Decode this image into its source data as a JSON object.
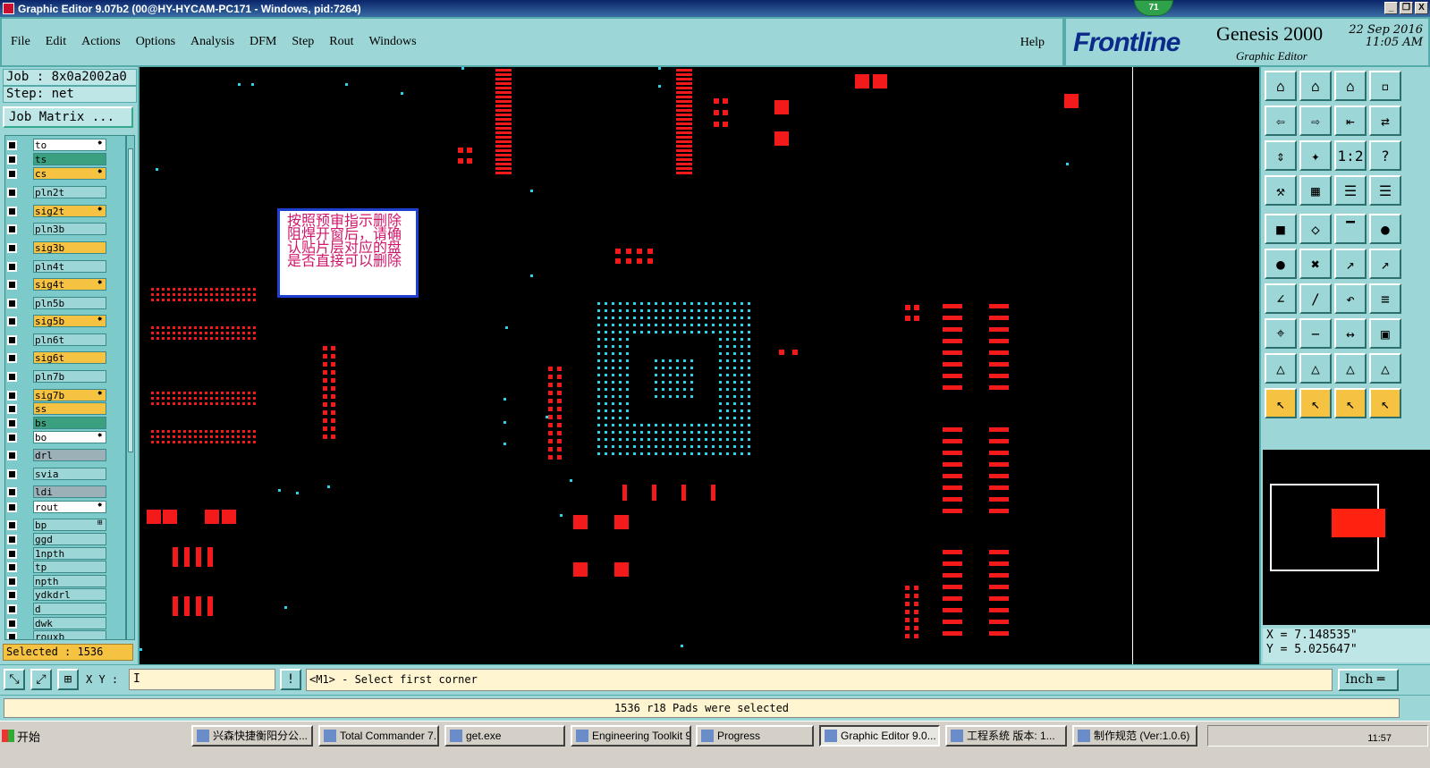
{
  "window": {
    "title": "Graphic Editor 9.07b2 (00@HY-HYCAM-PC171 - Windows, pid:7264)",
    "badge": "71",
    "controls": [
      "_",
      "❐",
      "X"
    ]
  },
  "menu": {
    "items": [
      "File",
      "Edit",
      "Actions",
      "Options",
      "Analysis",
      "DFM",
      "Step",
      "Rout",
      "Windows"
    ],
    "help": "Help"
  },
  "brand": {
    "logo": "Frontline",
    "product": "Genesis 2000",
    "subtitle": "Graphic Editor",
    "date": "22 Sep 2016",
    "time": "11:05 AM"
  },
  "left": {
    "job": "Job : 8x0a2002a0",
    "step": "Step: net",
    "job_matrix": "Job Matrix ...",
    "selected": "Selected : 1536",
    "layers": [
      {
        "name": "to",
        "color": "#ffffff",
        "arrow": "✸"
      },
      {
        "name": "ts",
        "color": "#3aa080",
        "arrow": ""
      },
      {
        "name": "cs",
        "color": "#f5c242",
        "arrow": "✸"
      },
      {
        "name": "pln2t",
        "color": "#9cd6d6",
        "arrow": ""
      },
      {
        "name": "sig2t",
        "color": "#f5c242",
        "arrow": "✸"
      },
      {
        "name": "pln3b",
        "color": "#9cd6d6",
        "arrow": ""
      },
      {
        "name": "sig3b",
        "color": "#f5c242",
        "arrow": ""
      },
      {
        "name": "pln4t",
        "color": "#9cd6d6",
        "arrow": ""
      },
      {
        "name": "sig4t",
        "color": "#f5c242",
        "arrow": "✸"
      },
      {
        "name": "pln5b",
        "color": "#9cd6d6",
        "arrow": ""
      },
      {
        "name": "sig5b",
        "color": "#f5c242",
        "arrow": "✸"
      },
      {
        "name": "pln6t",
        "color": "#9cd6d6",
        "arrow": ""
      },
      {
        "name": "sig6t",
        "color": "#f5c242",
        "arrow": ""
      },
      {
        "name": "pln7b",
        "color": "#9cd6d6",
        "arrow": ""
      },
      {
        "name": "sig7b",
        "color": "#f5c242",
        "arrow": "✸"
      },
      {
        "name": "ss",
        "color": "#f5c242",
        "arrow": ""
      },
      {
        "name": "bs",
        "color": "#3aa080",
        "arrow": ""
      },
      {
        "name": "bo",
        "color": "#ffffff",
        "arrow": "✸"
      },
      {
        "name": "drl",
        "color": "#9cb0b8",
        "arrow": ""
      },
      {
        "name": "svia",
        "color": "#9cd6d6",
        "arrow": ""
      },
      {
        "name": "ldi",
        "color": "#9cb0b8",
        "arrow": ""
      },
      {
        "name": "rout",
        "color": "#ffffff",
        "arrow": "✸"
      },
      {
        "name": "bp",
        "color": "#9cd6d6",
        "arrow": "⊞"
      },
      {
        "name": "ggd",
        "color": "#9cd6d6",
        "arrow": ""
      },
      {
        "name": "1npth",
        "color": "#9cd6d6",
        "arrow": ""
      },
      {
        "name": "tp",
        "color": "#9cd6d6",
        "arrow": ""
      },
      {
        "name": "npth",
        "color": "#9cd6d6",
        "arrow": ""
      },
      {
        "name": "ydkdrl",
        "color": "#9cd6d6",
        "arrow": ""
      },
      {
        "name": "d",
        "color": "#9cd6d6",
        "arrow": ""
      },
      {
        "name": "dwk",
        "color": "#9cd6d6",
        "arrow": ""
      },
      {
        "name": "rouxb",
        "color": "#9cd6d6",
        "arrow": ""
      }
    ]
  },
  "canvas": {
    "note": "按照预审指示删除阻焊开窗后，请确认贴片层对应的盘是否直接可以删除"
  },
  "right": {
    "tools": [
      "⌂",
      "⌂",
      "⌂",
      "▫",
      "⇦",
      "⇨",
      "⇤",
      "⇄",
      "⇕",
      "✦",
      "1:2",
      "?",
      "⚒",
      "▦",
      "☰",
      "☰",
      "■",
      "◇",
      "▔",
      "●",
      "●",
      "✖",
      "↗",
      "↗",
      "∠",
      "∕",
      "↶",
      "≡",
      "⌖",
      "−",
      "↔",
      "▣",
      "△",
      "△",
      "△",
      "△",
      "↖",
      "↖",
      "↖",
      "↖"
    ],
    "x": "X = 7.148535\"",
    "y": "Y = 5.025647\""
  },
  "cmd": {
    "xy_label": "X Y :",
    "xy_value": "I",
    "message": "<M1> - Select first corner",
    "unit": "Inch ═",
    "tools": [
      "⤡",
      "⤢",
      "⊞"
    ],
    "alert": "!"
  },
  "status": {
    "text": "1536 r18 Pads were selected"
  },
  "taskbar": {
    "start": "开始",
    "tasks": [
      {
        "label": "兴森快捷衡阳分公...",
        "active": false
      },
      {
        "label": "Total Commander 7....",
        "active": false
      },
      {
        "label": "get.exe",
        "active": false
      },
      {
        "label": "Engineering Toolkit 9....",
        "active": false
      },
      {
        "label": "Progress",
        "active": false
      },
      {
        "label": "Graphic Editor 9.0...",
        "active": true
      },
      {
        "label": "工程系统  版本: 1...",
        "active": false
      },
      {
        "label": "制作规范 (Ver:1.0.6)",
        "active": false
      }
    ],
    "time": "11:57"
  },
  "colors": {
    "red_pad": "#f21a1a",
    "cyan_pad": "#2ad4e8",
    "panel": "#9cd6d6"
  }
}
